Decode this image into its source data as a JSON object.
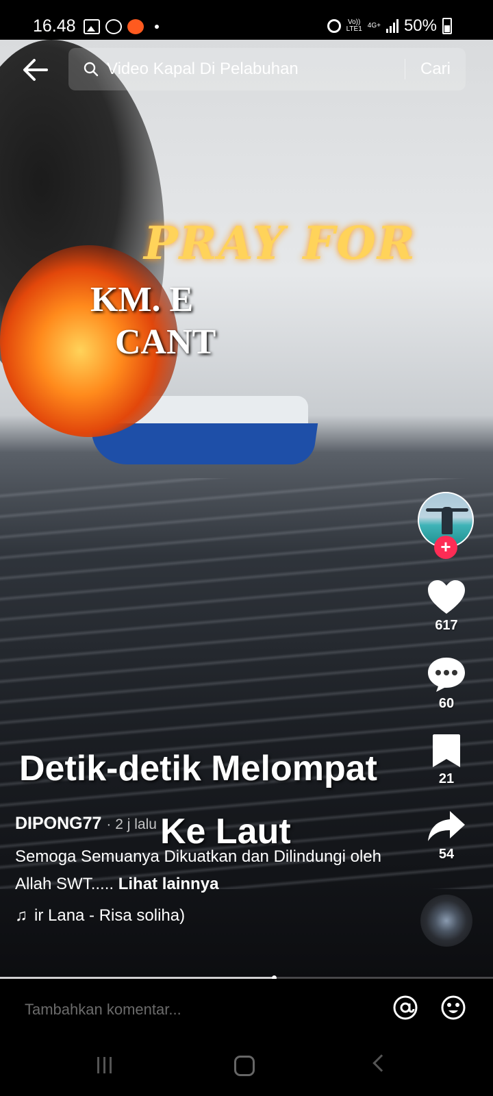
{
  "status_bar": {
    "time": "16.48",
    "volte": "Vo))",
    "lte": "LTE1",
    "network": "4G+",
    "battery": "50%",
    "icons": [
      "gallery-icon",
      "whatsapp-icon",
      "app-notification-icon",
      "dot-icon",
      "alarm-icon",
      "signal-icon",
      "battery-icon"
    ]
  },
  "search": {
    "query": "Video Kapal Di Pelabuhan",
    "button_label": "Cari"
  },
  "video_overlay": {
    "pray_text": "PRAY FOR",
    "ship_line1": "KM. E",
    "ship_line2": "CANT",
    "caption_line1": "Detik-detik Melompat",
    "caption_line2": "Ke Laut"
  },
  "actions": {
    "likes": "617",
    "comments": "60",
    "saves": "21",
    "shares": "54"
  },
  "post": {
    "username": "DIPONG77",
    "time_ago": "· 2 j lalu",
    "description": "Semoga Semuanya Dikuatkan dan Dilindungi oleh Allah SWT.....",
    "see_more": "Lihat lainnya",
    "music": "ir Lana - Risa soliha)"
  },
  "playback": {
    "progress": 0.555
  },
  "comment_bar": {
    "placeholder": "Tambahkan komentar..."
  },
  "colors": {
    "accent": "#fe2c55",
    "background": "#000000"
  }
}
